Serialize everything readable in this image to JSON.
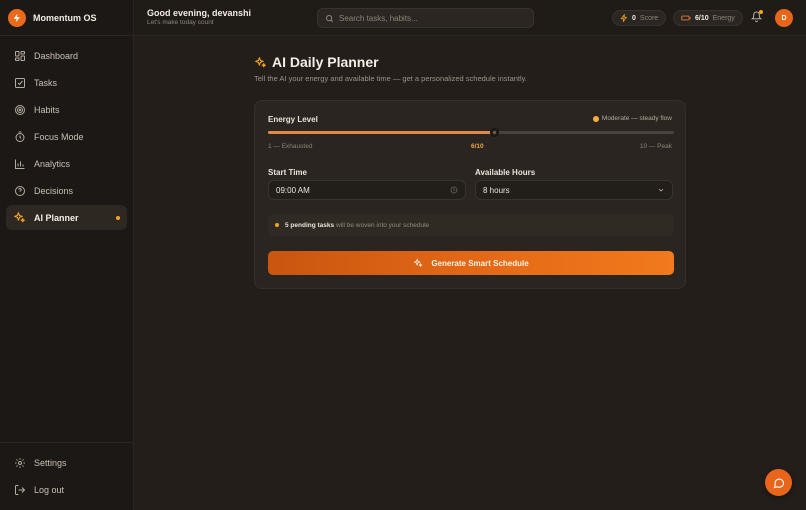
{
  "app": {
    "name": "Momentum OS"
  },
  "sidebar": {
    "items": [
      {
        "label": "Dashboard",
        "icon": "dashboard-icon",
        "active": false
      },
      {
        "label": "Tasks",
        "icon": "checkbox-icon",
        "active": false
      },
      {
        "label": "Habits",
        "icon": "target-icon",
        "active": false
      },
      {
        "label": "Focus Mode",
        "icon": "timer-icon",
        "active": false
      },
      {
        "label": "Analytics",
        "icon": "bar-chart-icon",
        "active": false
      },
      {
        "label": "Decisions",
        "icon": "help-circle-icon",
        "active": false
      },
      {
        "label": "AI Planner",
        "icon": "sparkles-icon",
        "active": true
      }
    ],
    "bottom": [
      {
        "label": "Settings",
        "icon": "gear-icon"
      },
      {
        "label": "Log out",
        "icon": "logout-icon"
      }
    ]
  },
  "header": {
    "greeting": "Good evening, devanshi",
    "subtext": "Let's make today count",
    "search_placeholder": "Search tasks, habits...",
    "score_value": "0",
    "score_label": "Score",
    "energy_value": "6/10",
    "energy_label": "Energy",
    "avatar_initial": "D"
  },
  "planner": {
    "title": "AI Daily Planner",
    "subtitle": "Tell the AI your energy and available time — get a personalized schedule instantly.",
    "energy_label": "Energy Level",
    "energy_mood": "Moderate — steady flow",
    "energy_level": 6,
    "energy_max": 10,
    "energy_display": "6/10",
    "scale_min": "1 — Exhausted",
    "scale_max": "10 — Peak",
    "start_time_label": "Start Time",
    "start_time_value": "09:00 AM",
    "hours_label": "Available Hours",
    "hours_value": "8 hours",
    "pending_count_text": "5 pending tasks",
    "pending_rest_text": "will be woven into your schedule",
    "generate_label": "Generate Smart Schedule"
  },
  "colors": {
    "accent": "#e8651a",
    "accent_dot": "#f4a321",
    "background": "#231e1a"
  }
}
